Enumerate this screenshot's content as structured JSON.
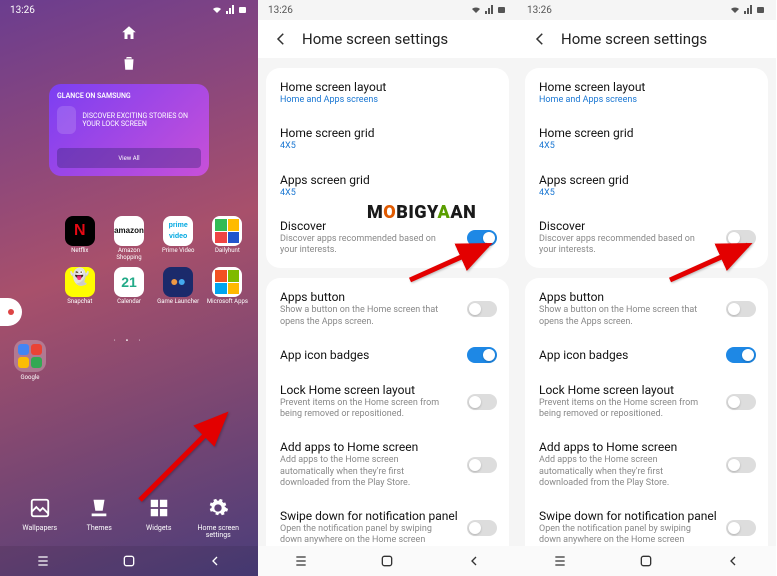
{
  "watermark": "MOBIGYAAN",
  "status": {
    "time": "13:26"
  },
  "panel1": {
    "glance_title": "GLANCE ON SAMSUNG",
    "glance_text": "DISCOVER EXCITING STORIES ON YOUR LOCK SCREEN",
    "glance_viewall": "View All",
    "apps_row1": [
      {
        "label": "Netflix",
        "bg": "#000"
      },
      {
        "label": "Amazon Shopping",
        "bg": "#fff"
      },
      {
        "label": "Prime Video",
        "bg": "#fff"
      },
      {
        "label": "Dailyhunt",
        "bg": "#fff"
      }
    ],
    "apps_row2": [
      {
        "label": "Snapchat",
        "bg": "#fffc00"
      },
      {
        "label": "Calendar",
        "bg": "#fff",
        "text": "21"
      },
      {
        "label": "Game Launcher",
        "bg": "#1b2a6b"
      },
      {
        "label": "Microsoft Apps",
        "bg": "#fff"
      }
    ],
    "folder_label": "Google",
    "bottom": [
      {
        "label": "Wallpapers"
      },
      {
        "label": "Themes"
      },
      {
        "label": "Widgets"
      },
      {
        "label": "Home screen settings"
      }
    ]
  },
  "settings_title": "Home screen settings",
  "groups": {
    "g1": [
      {
        "title": "Home screen layout",
        "sub": "Home and Apps screens",
        "blue": true
      },
      {
        "title": "Home screen grid",
        "sub": "4X5",
        "blue": true
      },
      {
        "title": "Apps screen grid",
        "sub": "4X5",
        "blue": true
      },
      {
        "title": "Discover",
        "sub": "Discover apps recommended based on your interests.",
        "toggle": true
      }
    ],
    "g2": [
      {
        "title": "Apps button",
        "sub": "Show a button on the Home screen that opens the Apps screen.",
        "toggle": true
      },
      {
        "title": "App icon badges",
        "toggle": true
      },
      {
        "title": "Lock Home screen layout",
        "sub": "Prevent items on the Home screen from being removed or repositioned.",
        "toggle": true
      },
      {
        "title": "Add apps to Home screen",
        "sub": "Add apps to the Home screen automatically when they're first downloaded from the Play Store.",
        "toggle": true
      },
      {
        "title": "Swipe down for notification panel",
        "sub": "Open the notification panel by swiping down anywhere on the Home screen",
        "toggle": true
      }
    ]
  },
  "panel2_toggles": {
    "discover": true,
    "apps_button": false,
    "badges": true,
    "lock": false,
    "add": false,
    "swipe": false
  },
  "panel3_toggles": {
    "discover": false,
    "apps_button": false,
    "badges": true,
    "lock": false,
    "add": false,
    "swipe": false
  }
}
